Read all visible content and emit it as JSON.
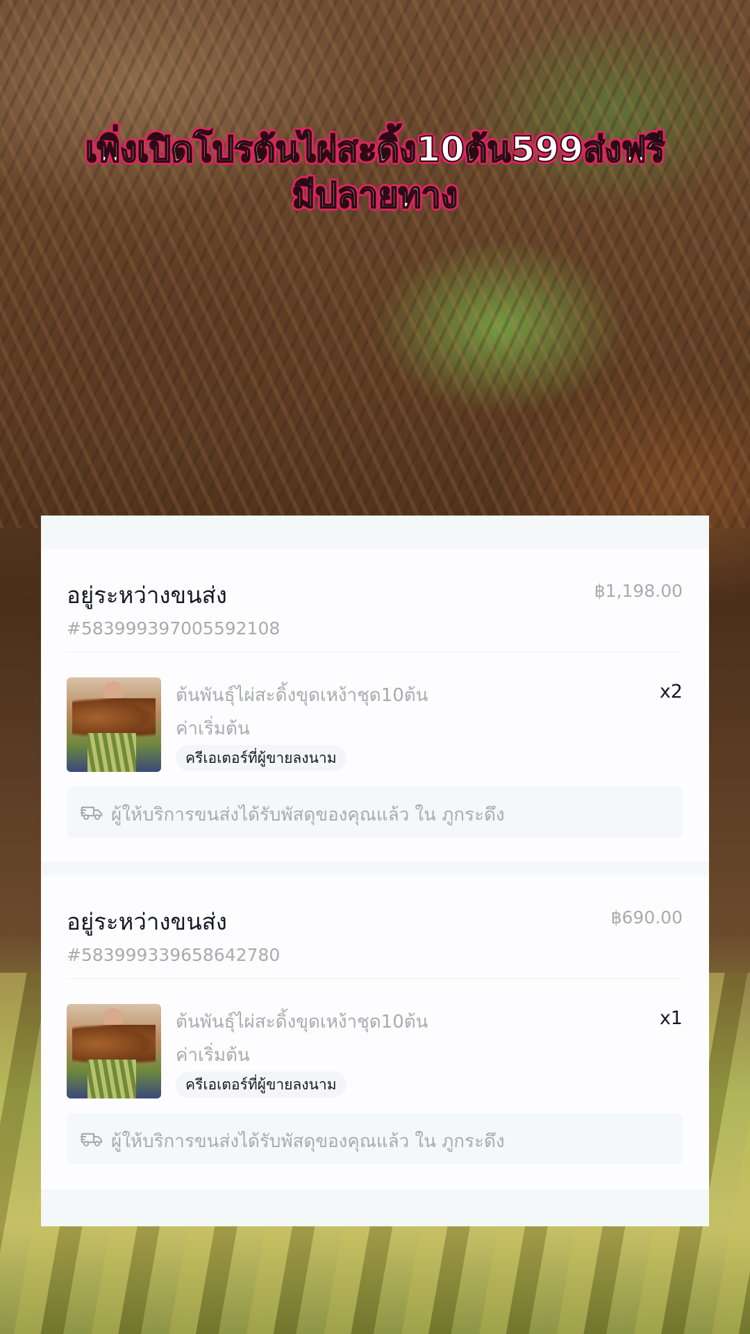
{
  "caption": {
    "line1": "เพิ่งเปิดโปรต้นไผ่สะดิ้ง10ต้น599ส่งฟรี",
    "line2": "มีปลายทาง"
  },
  "orders": [
    {
      "status": "อยู่ระหว่างขนส่ง",
      "order_id": "#583999397005592108",
      "price": "฿1,198.00",
      "product_name": "ต้นพันธุ์ไผ่สะดิ้งขุดเหง้าชุด10ต้น",
      "variant": "ค่าเริ่มต้น",
      "quantity": "x2",
      "badge": "ครีเอเตอร์ที่ผู้ขายลงนาม",
      "shipping_icon": "delivery-truck-icon",
      "shipping_text": "ผู้ให้บริการขนส่งได้รับพัสดุของคุณแล้ว ใน ภูกระดึง"
    },
    {
      "status": "อยู่ระหว่างขนส่ง",
      "order_id": "#583999339658642780",
      "price": "฿690.00",
      "product_name": "ต้นพันธุ์ไผ่สะดิ้งขุดเหง้าชุด10ต้น",
      "variant": "ค่าเริ่มต้น",
      "quantity": "x1",
      "badge": "ครีเอเตอร์ที่ผู้ขายลงนาม",
      "shipping_icon": "delivery-truck-icon",
      "shipping_text": "ผู้ให้บริการขนส่งได้รับพัสดุของคุณแล้ว ใน ภูกระดึง"
    }
  ],
  "colors": {
    "caption_outline": "#e0245e",
    "text_primary": "#161823",
    "text_secondary": "#a9aab0",
    "card_bg": "#fdfdff",
    "panel_bg": "#f5f8f8"
  }
}
